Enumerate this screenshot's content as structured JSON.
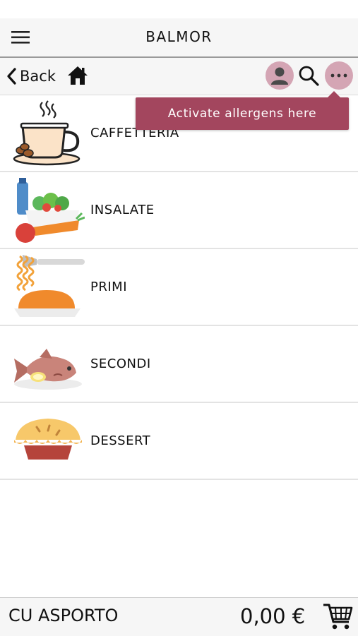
{
  "header": {
    "title": "BALMOR",
    "menu_icon": "hamburger-menu-icon"
  },
  "toolbar": {
    "back_label": "Back",
    "icons": [
      "chevron-left-icon",
      "home-icon",
      "user-icon",
      "search-icon",
      "more-icon"
    ]
  },
  "tooltip": {
    "text": "Activate allergens here"
  },
  "categories": [
    {
      "label": "CAFFETTERIA",
      "icon": "coffee-cup-icon"
    },
    {
      "label": "INSALATE",
      "icon": "salad-icon"
    },
    {
      "label": "PRIMI",
      "icon": "pasta-icon"
    },
    {
      "label": "SECONDI",
      "icon": "fish-dish-icon"
    },
    {
      "label": "DESSERT",
      "icon": "pie-icon"
    }
  ],
  "footer": {
    "order_type": "CU ASPORTO",
    "total": "0,00 €",
    "cart_icon": "cart-icon"
  },
  "colors": {
    "accent": "#a3465e",
    "button_bg": "#d4a5b4",
    "bar_bg": "#f6f6f6"
  }
}
